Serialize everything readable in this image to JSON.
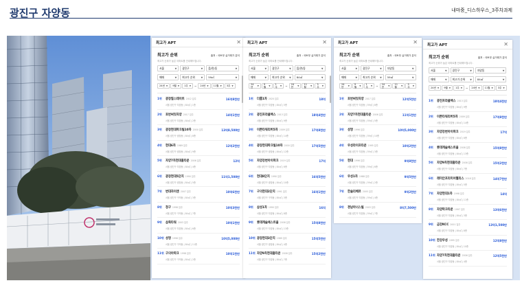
{
  "page": {
    "title": "광진구 자양동",
    "top_right": "내마중_디스하우스_3주차과제"
  },
  "colors": {
    "brand": "#1f3a6e",
    "accent": "#2255d6",
    "panel_bg": "#d7e3f4"
  },
  "cards": [
    {
      "header": "최고가 APT",
      "section": "최고가 순위",
      "source": "출처 : 국토부 실거래가 분석",
      "desc": "최고가 순위가 높은 아파트를 안내해드립니다.",
      "filters": {
        "sido": "서울",
        "gu": "광진구",
        "dong": "읍/면/동",
        "trade": "매매",
        "sort": "최고가 순위",
        "area": "59㎡"
      },
      "period": {
        "y1": "24년",
        "m1": "9월",
        "w1": "1주",
        "y2": "24년",
        "m2": "11월",
        "w2": "3주"
      },
      "items": [
        {
          "rank": "1위",
          "name": "광장힐스테이트",
          "year": "2012 입주",
          "meta": "서울 광진구 자양동 | 84㎡ | 1층",
          "price": "16억8천만"
        },
        {
          "rank": "2위",
          "name": "호반써밋자양",
          "year": "2017 입주",
          "meta": "서울 광진구 자양동 | 84㎡ | 2층",
          "price": "14억1천만"
        },
        {
          "rank": "3위",
          "name": "광장현대파크빌10차",
          "year": "2000 입주",
          "meta": "서울 광진구 광장동 | 84㎡ | 8층",
          "price": "13억8,500만"
        },
        {
          "rank": "4위",
          "name": "현대6차",
          "year": "1989 입주",
          "meta": "서울 광진구 광장동 | 84㎡ | 9층",
          "price": "12억2천만"
        },
        {
          "rank": "5위",
          "name": "자양7차현대홈타운",
          "year": "2006 입주",
          "meta": "서울 광진구 자양동 | 84㎡ | 4층",
          "price": "12억"
        },
        {
          "rank": "6위",
          "name": "광장현대5단지",
          "year": "1990 입주",
          "meta": "서울 광진구 광장동 | 84㎡ | 5층",
          "price": "11억1,500만"
        },
        {
          "rank": "7위",
          "name": "변대자이앤",
          "year": "2007 입주",
          "meta": "서울 광진구 구의동 | 84㎡ | 3층",
          "price": "10억6천만"
        },
        {
          "rank": "8위",
          "name": "청구",
          "year": "1998 입주",
          "meta": "서울 광진구 구의동 | 84㎡ | 7층",
          "price": "10억3천만"
        },
        {
          "rank": "9위",
          "name": "삼축타워",
          "year": "2003 입주",
          "meta": "서울 광진구 자양동 | 84㎡ | 6층",
          "price": "10억1천만"
        },
        {
          "rank": "10위",
          "name": "성영",
          "year": "1996 입주",
          "meta": "서울 광진구 구의동 | 84㎡ | 11층",
          "price": "10억5,000만"
        },
        {
          "rank": "11위",
          "name": "구의아파크",
          "year": "1998 입주",
          "meta": "서울 광진구 구의동 | 84㎡ | 2층",
          "price": "10억1천만"
        }
      ]
    },
    {
      "header": "최고가 APT",
      "section": "최고가 순위",
      "source": "출처 : 국토부 실거래가 분석",
      "desc": "최고가 순위가 높은 아파트를 안내해드립니다.",
      "filters": {
        "sido": "서울",
        "gu": "광진구",
        "dong": "읍/면/동",
        "trade": "매매",
        "sort": "최고가 순위",
        "area": "84㎡"
      },
      "period": {
        "y1": "24년",
        "m1": "9월",
        "w1": "1주",
        "y2": "24년",
        "m2": "11월",
        "w2": "3주"
      },
      "items": [
        {
          "rank": "1위",
          "name": "더룸1차",
          "year": "2020 입주",
          "meta": "서울 광진구 자양동 | 84㎡ | 5층",
          "price": "18억"
        },
        {
          "rank": "2위",
          "name": "광진프라클렉스",
          "year": "2013 입주",
          "meta": "서울 광진구 자양동 | 84㎡ | 9층",
          "price": "18억4천만"
        },
        {
          "rank": "3위",
          "name": "이튼타워리버5차",
          "year": "2009 입주",
          "meta": "서울 광진구 자양동 | 84㎡ | 14층",
          "price": "17억8천만"
        },
        {
          "rank": "4위",
          "name": "광장현대파크빌10차",
          "year": "2000 입주",
          "meta": "서울 광진구 광장동 | 84㎡ | 12층",
          "price": "17억5천만"
        },
        {
          "rank": "5위",
          "name": "자양강변아이파크",
          "year": "2019 입주",
          "meta": "서울 광진구 자양동 | 84㎡ | 6층",
          "price": "17억"
        },
        {
          "rank": "6위",
          "name": "현대8단지",
          "year": "1990 입주",
          "meta": "서울 광진구 광장동 | 84㎡ | 10층",
          "price": "16억5천만"
        },
        {
          "rank": "7위",
          "name": "구의현대2단지",
          "year": "1991 입주",
          "meta": "서울 광진구 구의동 | 84㎡ | 3층",
          "price": "16억1천만"
        },
        {
          "rank": "8위",
          "name": "삼성1차",
          "year": "1990 입주",
          "meta": "서울 광진구 자양동 | 84㎡ | 8층",
          "price": "16억"
        },
        {
          "rank": "9위",
          "name": "롯데캐슬에스트을",
          "year": "2008 입주",
          "meta": "서울 광진구 자양동 | 84㎡ | 13층",
          "price": "15억8천만"
        },
        {
          "rank": "10위",
          "name": "광장현대3단지",
          "year": "1989 입주",
          "meta": "서울 광진구 광장동 | 84㎡ | 4층",
          "price": "15억5천만"
        },
        {
          "rank": "11위",
          "name": "자양9차현대홈타운",
          "year": "2008 입주",
          "meta": "서울 광진구 자양동 | 84㎡ | 7층",
          "price": "15억2천만"
        }
      ]
    },
    {
      "header": "최고가 APT",
      "section": "최고가 순위",
      "source": "출처 : 국토부 실거래가 분석",
      "desc": "최고가 순위가 높은 아파트를 안내해드립니다.",
      "filters": {
        "sido": "서울",
        "gu": "광진구",
        "dong": "자양동",
        "trade": "매매",
        "sort": "최고가 순위",
        "area": "59㎡"
      },
      "period": {
        "y1": "24년",
        "m1": "9월",
        "w1": "1주",
        "y2": "24년",
        "m2": "11월",
        "w2": "3주"
      },
      "items": [
        {
          "rank": "1위",
          "name": "호반써밋자양",
          "year": "2017 입주",
          "meta": "서울 광진구 자양동 | 59㎡ | 8층",
          "price": "12억5천만"
        },
        {
          "rank": "2위",
          "name": "자양7차현대홈타운",
          "year": "2006 입주",
          "meta": "서울 광진구 자양동 | 59㎡ | 5층",
          "price": "11억1천만"
        },
        {
          "rank": "3위",
          "name": "성영",
          "year": "1996 입주",
          "meta": "서울 광진구 자양동 | 59㎡ | 10층",
          "price": "10억5,000만"
        },
        {
          "rank": "4위",
          "name": "우성라이프타운",
          "year": "1995 입주",
          "meta": "서울 광진구 자양동 | 59㎡ | 3층",
          "price": "10억2천만"
        },
        {
          "rank": "5위",
          "name": "현대",
          "year": "1996 입주",
          "meta": "서울 광진구 자양동 | 59㎡ | 6층",
          "price": "9억8천만"
        },
        {
          "rank": "6위",
          "name": "우성1차",
          "year": "1988 입주",
          "meta": "서울 광진구 자양동 | 59㎡ | 2층",
          "price": "9억5천만"
        },
        {
          "rank": "7위",
          "name": "한솔리베르",
          "year": "2005 입주",
          "meta": "서울 광진구 자양동 | 59㎡ | 4층",
          "price": "9억2천만"
        },
        {
          "rank": "8위",
          "name": "경남아너스빌",
          "year": "2003 입주",
          "meta": "서울 광진구 자양동 | 59㎡ | 7층",
          "price": "8억7,500만"
        }
      ]
    },
    {
      "header": "최고가 APT",
      "section": "최고가 순위",
      "source": "출처 : 국토부 실거래가 분석",
      "desc": "최고가 순위가 높은 아파트를 안내해드립니다.",
      "filters": {
        "sido": "서울",
        "gu": "광진구",
        "dong": "자양동",
        "trade": "매매",
        "sort": "최고가 순위",
        "area": "84㎡"
      },
      "period": {
        "y1": "24년",
        "m1": "9월",
        "w1": "1주",
        "y2": "24년",
        "m2": "11월",
        "w2": "3주"
      },
      "items": [
        {
          "rank": "1위",
          "name": "광진프라클렉스",
          "year": "2013 입주",
          "meta": "서울 광진구 자양동 | 84㎡ | 9층",
          "price": "18억4천만"
        },
        {
          "rank": "2위",
          "name": "이튼타워리버5차",
          "year": "2009 입주",
          "meta": "서울 광진구 자양동 | 84㎡ | 14층",
          "price": "17억8천만"
        },
        {
          "rank": "3위",
          "name": "자양강변아이파크",
          "year": "2019 입주",
          "meta": "서울 광진구 자양동 | 84㎡ | 6층",
          "price": "17억"
        },
        {
          "rank": "4위",
          "name": "롯데캐슬에스트을",
          "year": "2008 입주",
          "meta": "서울 광진구 자양동 | 84㎡ | 13층",
          "price": "15억8천만"
        },
        {
          "rank": "5위",
          "name": "자양9차현대홈타운",
          "year": "2008 입주",
          "meta": "서울 광진구 자양동 | 84㎡ | 7층",
          "price": "15억2천만"
        },
        {
          "rank": "6위",
          "name": "래미안프리미어팰리스",
          "year": "2018 입주",
          "meta": "서울 광진구 자양동 | 84㎡ | 5층",
          "price": "14억7천만"
        },
        {
          "rank": "7위",
          "name": "자양현대1차",
          "year": "1998 입주",
          "meta": "서울 광진구 자양동 | 84㎡ | 11층",
          "price": "14억"
        },
        {
          "rank": "8위",
          "name": "자양파크타운",
          "year": "1997 입주",
          "meta": "서울 광진구 자양동 | 84㎡ | 3층",
          "price": "13억6천만"
        },
        {
          "rank": "9위",
          "name": "금강KCC",
          "year": "2001 입주",
          "meta": "서울 광진구 자양동 | 84㎡ | 8층",
          "price": "13억1,500만"
        },
        {
          "rank": "10위",
          "name": "한강우성",
          "year": "1995 입주",
          "meta": "서울 광진구 자양동 | 84㎡ | 10층",
          "price": "12억8천만"
        },
        {
          "rank": "11위",
          "name": "자양7차현대홈타운",
          "year": "2006 입주",
          "meta": "서울 광진구 자양동 | 84㎡ | 4층",
          "price": "12억5천만"
        }
      ]
    }
  ]
}
